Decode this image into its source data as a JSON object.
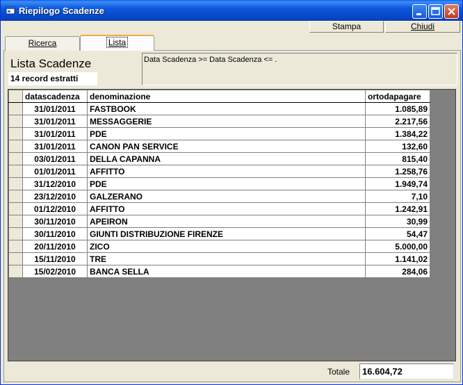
{
  "window": {
    "title": "Riepilogo Scadenze"
  },
  "toolbar": {
    "stampa_label": "Stampa",
    "chiudi_label": "Chiudi"
  },
  "tabs": [
    {
      "label": "Ricerca",
      "active": false
    },
    {
      "label": "Lista",
      "active": true
    }
  ],
  "panel": {
    "title": "Lista Scadenze",
    "record_count": "14 record estratti",
    "filter_text": "Data Scadenza >=    Data Scadenza <=  ."
  },
  "table": {
    "columns": [
      "datascadenza",
      "denominazione",
      "ortodapagare"
    ],
    "rows": [
      [
        "31/01/2011",
        "FASTBOOK",
        "1.085,89"
      ],
      [
        "31/01/2011",
        "MESSAGGERIE",
        "2.217,56"
      ],
      [
        "31/01/2011",
        "PDE",
        "1.384,22"
      ],
      [
        "31/01/2011",
        "CANON PAN SERVICE",
        "132,60"
      ],
      [
        "03/01/2011",
        "DELLA CAPANNA",
        "815,40"
      ],
      [
        "01/01/2011",
        "AFFITTO",
        "1.258,76"
      ],
      [
        "31/12/2010",
        "PDE",
        "1.949,74"
      ],
      [
        "23/12/2010",
        "GALZERANO",
        "7,10"
      ],
      [
        "01/12/2010",
        "AFFITTO",
        "1.242,91"
      ],
      [
        "30/11/2010",
        "APEIRON",
        "30,99"
      ],
      [
        "30/11/2010",
        "GIUNTI DISTRIBUZIONE FIRENZE",
        "54,47"
      ],
      [
        "20/11/2010",
        "ZICO",
        "5.000,00"
      ],
      [
        "15/11/2010",
        "TRE",
        "1.141,02"
      ],
      [
        "15/02/2010",
        "BANCA SELLA",
        "284,06"
      ]
    ]
  },
  "footer": {
    "totale_label": "Totale",
    "totale_value": "16.604,72"
  },
  "colors": {
    "titlebar": "#0843c5",
    "face": "#ece9d8",
    "grid_bg": "#808080",
    "tab_accent": "#f0a94e"
  },
  "icons": [
    "app-window-icon",
    "minimize-icon",
    "maximize-icon",
    "close-icon"
  ]
}
